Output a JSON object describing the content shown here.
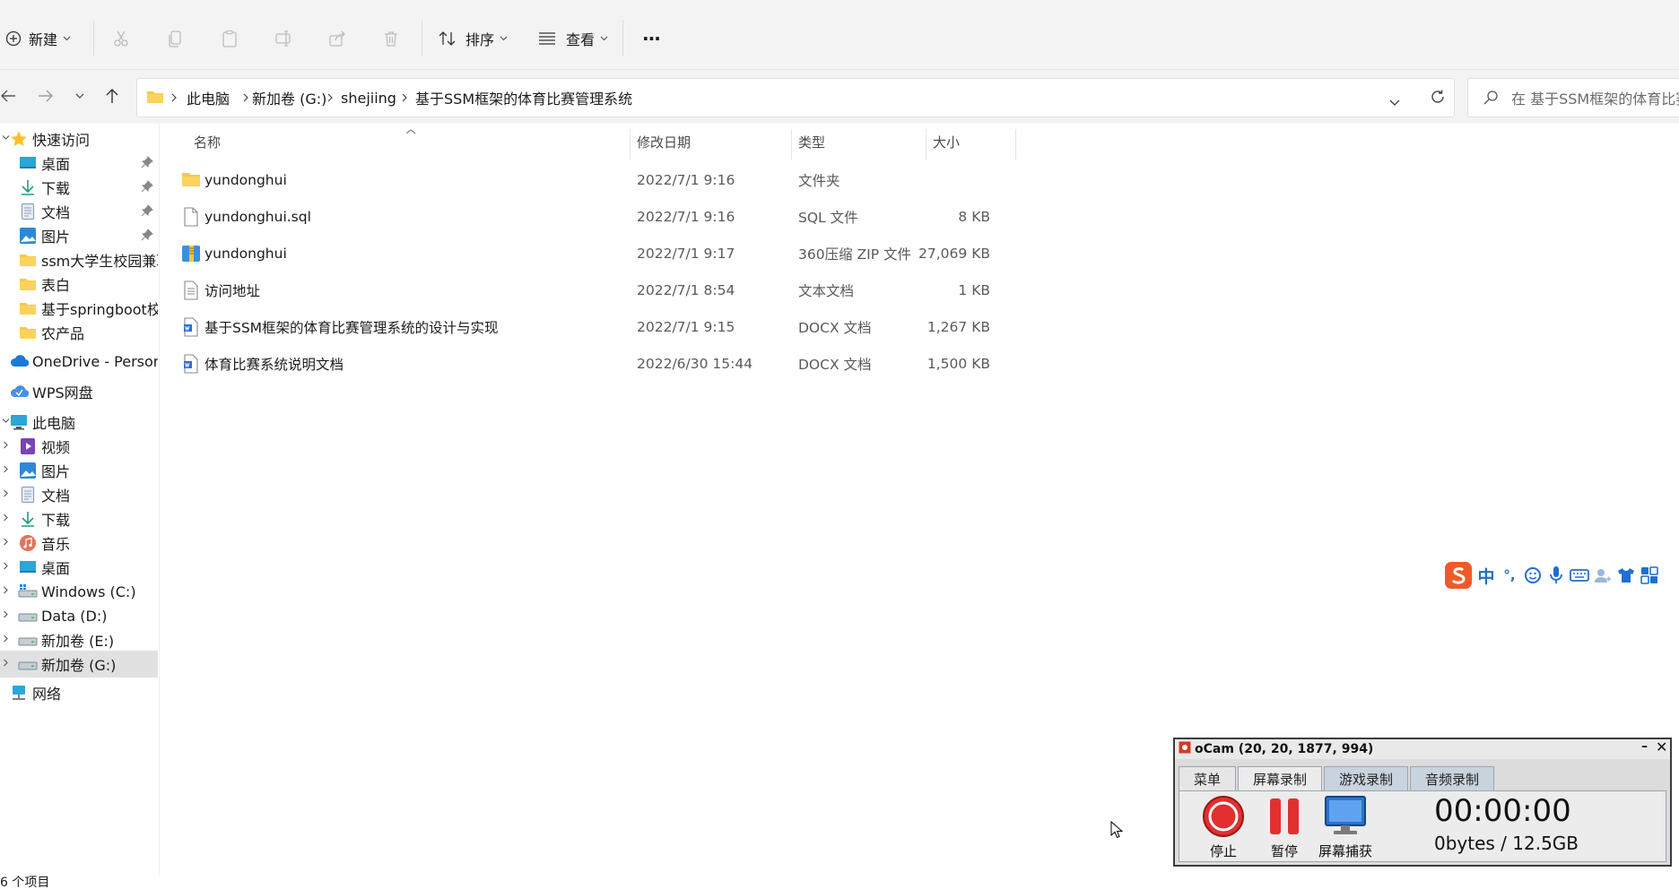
{
  "toolbar": {
    "new_label": "新建",
    "sort_label": "排序",
    "view_label": "查看",
    "more_label": "···"
  },
  "address": {
    "crumbs": [
      "此电脑",
      "新加卷 (G:)",
      "shejiing",
      "基于SSM框架的体育比赛管理系统"
    ],
    "search_placeholder": "在 基于SSM框架的体育比赛"
  },
  "nav": {
    "quick_access": "快速访问",
    "quick_items": [
      {
        "label": "桌面",
        "icon": "desktop-icon",
        "pinned": true
      },
      {
        "label": "下载",
        "icon": "download-icon",
        "pinned": true
      },
      {
        "label": "文档",
        "icon": "document-icon",
        "pinned": true
      },
      {
        "label": "图片",
        "icon": "picture-icon",
        "pinned": true
      },
      {
        "label": "ssm大学生校园兼职",
        "icon": "folder-icon",
        "pinned": false
      },
      {
        "label": "表白",
        "icon": "folder-icon",
        "pinned": false
      },
      {
        "label": "基于springboot校园",
        "icon": "folder-icon",
        "pinned": false
      },
      {
        "label": "农产品",
        "icon": "folder-icon",
        "pinned": false
      }
    ],
    "onedrive": "OneDrive - Personal",
    "wps": "WPS网盘",
    "this_pc": "此电脑",
    "pc_items": [
      {
        "label": "视频",
        "icon": "video-icon"
      },
      {
        "label": "图片",
        "icon": "picture-icon"
      },
      {
        "label": "文档",
        "icon": "document-icon"
      },
      {
        "label": "下载",
        "icon": "download-icon"
      },
      {
        "label": "音乐",
        "icon": "music-icon"
      },
      {
        "label": "桌面",
        "icon": "desktop-icon"
      },
      {
        "label": "Windows (C:)",
        "icon": "drive-icon"
      },
      {
        "label": "Data (D:)",
        "icon": "drive-icon"
      },
      {
        "label": "新加卷 (E:)",
        "icon": "drive-icon"
      },
      {
        "label": "新加卷 (G:)",
        "icon": "drive-icon"
      }
    ],
    "network": "网络"
  },
  "columns": {
    "name": "名称",
    "date": "修改日期",
    "type": "类型",
    "size": "大小"
  },
  "files": [
    {
      "name": "yundonghui",
      "date": "2022/7/1 9:16",
      "type": "文件夹",
      "size": "",
      "icon": "folder-icon"
    },
    {
      "name": "yundonghui.sql",
      "date": "2022/7/1 9:16",
      "type": "SQL 文件",
      "size": "8 KB",
      "icon": "file-icon"
    },
    {
      "name": "yundonghui",
      "date": "2022/7/1 9:17",
      "type": "360压缩 ZIP 文件",
      "size": "27,069 KB",
      "icon": "zip-icon"
    },
    {
      "name": "访问地址",
      "date": "2022/7/1 8:54",
      "type": "文本文档",
      "size": "1 KB",
      "icon": "text-file-icon"
    },
    {
      "name": "基于SSM框架的体育比赛管理系统的设计与实现",
      "date": "2022/7/1 9:15",
      "type": "DOCX 文档",
      "size": "1,267 KB",
      "icon": "docx-icon"
    },
    {
      "name": "体育比赛系统说明文档",
      "date": "2022/6/30 15:44",
      "type": "DOCX 文档",
      "size": "1,500 KB",
      "icon": "docx-icon"
    }
  ],
  "status": {
    "item_count": "6 个项目"
  },
  "ime": {
    "mode": "中",
    "punct": "°,"
  },
  "ocam": {
    "title": "oCam (20, 20, 1877, 994)",
    "tabs": [
      "菜单",
      "屏幕录制",
      "游戏录制",
      "音频录制"
    ],
    "active_tab": 1,
    "stop": "停止",
    "pause": "暂停",
    "capture": "屏幕捕获",
    "timer": "00:00:00",
    "storage": "0bytes / 12.5GB"
  }
}
